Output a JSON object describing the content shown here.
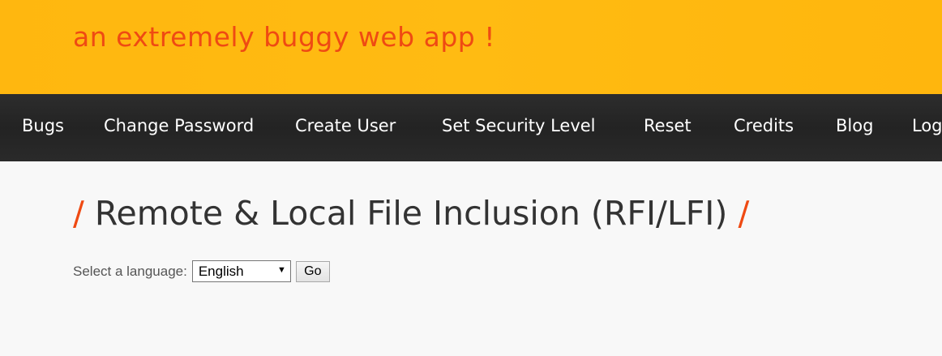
{
  "header": {
    "tagline": "an extremely buggy web app !"
  },
  "nav": {
    "items": [
      {
        "label": "Bugs"
      },
      {
        "label": "Change Password"
      },
      {
        "label": "Create User"
      },
      {
        "label": "Set Security Level"
      },
      {
        "label": "Reset"
      },
      {
        "label": "Credits"
      },
      {
        "label": "Blog"
      },
      {
        "label": "Logout"
      }
    ]
  },
  "main": {
    "title_prefix": "/",
    "title": "Remote & Local File Inclusion (RFI/LFI)",
    "title_suffix": "/",
    "form": {
      "label": "Select a language:",
      "selected_language": "English",
      "go_label": "Go"
    }
  },
  "colors": {
    "header_bg": "#ffb70f",
    "accent": "#ef4a13",
    "nav_bg": "#2a2a2a",
    "title_text": "#333333"
  }
}
